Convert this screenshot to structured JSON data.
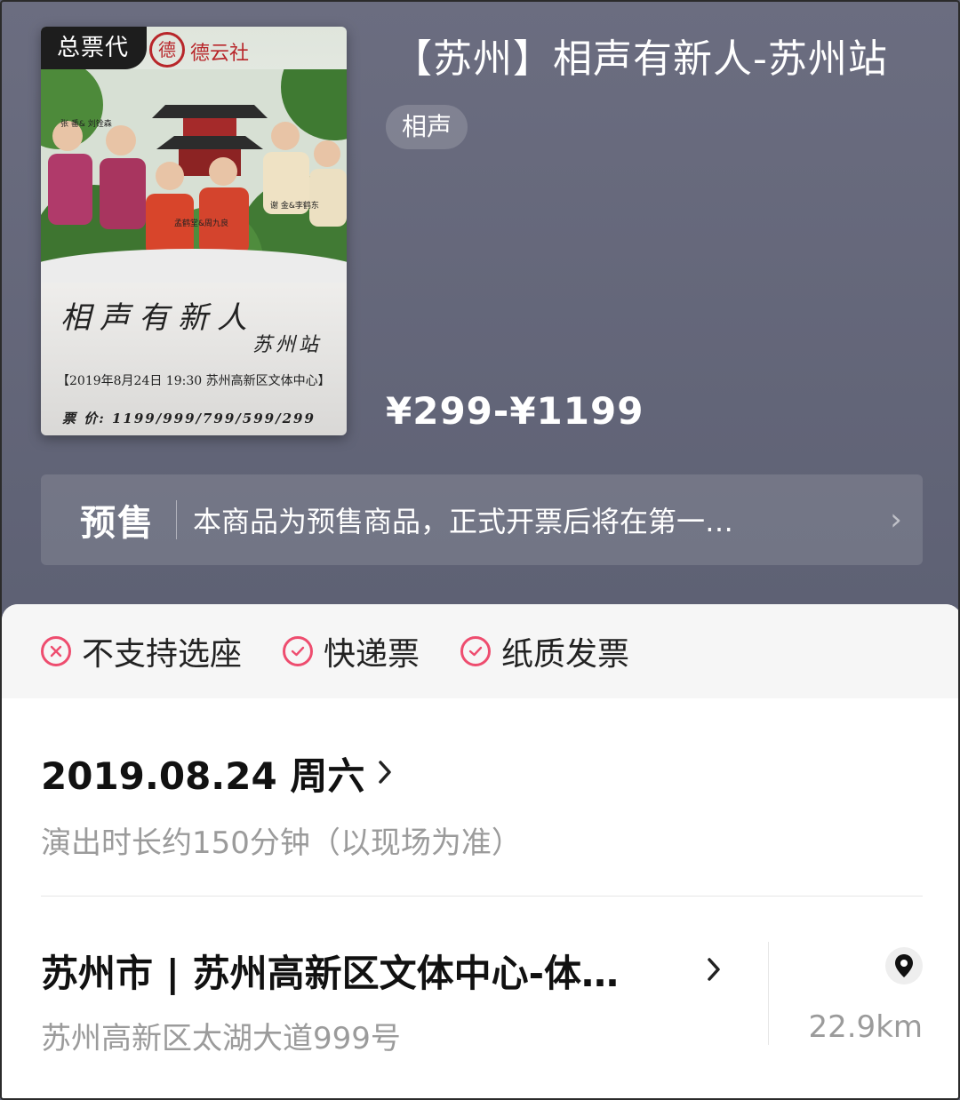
{
  "poster": {
    "badge": "总票代",
    "seal_char": "德",
    "brand": "德云社",
    "names_left": "张 番& 刘铨森",
    "names_center": "孟鹤堂&周九良",
    "names_right": "谢 金&李鹤东",
    "calligraphy_title": "相声有新人",
    "calligraphy_station": "苏州站",
    "info": "【2019年8月24日 19:30 苏州高新区文体中心】",
    "price_line": "票 价: 1199/999/799/599/299"
  },
  "header": {
    "title": "【苏州】相声有新人-苏州站",
    "tag": "相声",
    "price": "¥299-¥1199"
  },
  "presale": {
    "label": "预售",
    "text": "本商品为预售商品，正式开票后将在第一…",
    "chevron": "›"
  },
  "features": [
    {
      "icon": "x-circle-icon",
      "text": "不支持选座"
    },
    {
      "icon": "check-circle-icon",
      "text": "快递票"
    },
    {
      "icon": "check-circle-icon",
      "text": "纸质发票"
    }
  ],
  "session": {
    "date": "2019.08.24 周六",
    "duration": "演出时长约150分钟（以现场为准）"
  },
  "venue": {
    "name": "苏州市 | 苏州高新区文体中心-体…",
    "address": "苏州高新区太湖大道999号",
    "distance": "22.9km"
  },
  "colors": {
    "accent": "#ee4d6f",
    "header_bg": "#5e6174"
  }
}
